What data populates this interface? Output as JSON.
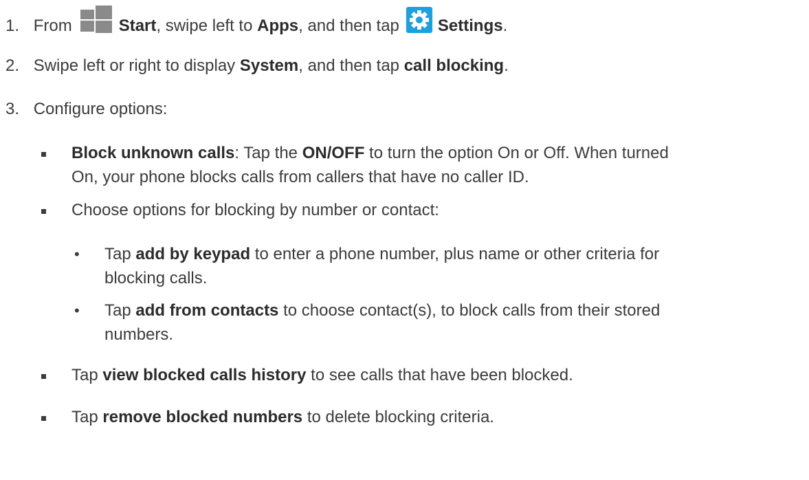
{
  "steps": [
    {
      "num": "1.",
      "p1": "From",
      "start": "Start",
      "p2": ", swipe left to",
      "apps": "Apps",
      "p3": ", and then tap",
      "settings": "Settings",
      "p4": "."
    },
    {
      "num": "2.",
      "p1": "Swipe left or right to display",
      "system": "System",
      "p2": ", and then tap",
      "call_blocking": "call blocking",
      "p3": "."
    },
    {
      "num": "3.",
      "text": "Configure options:"
    }
  ],
  "options": {
    "block_unknown": {
      "bold": "Block unknown calls",
      "t1": ": Tap the",
      "onoff": "ON/OFF",
      "t2": "to turn the option On or Off. When turned",
      "line2": "On, your phone blocks calls from callers that have no caller ID."
    },
    "choose": {
      "text": "Choose options for blocking by number or contact:"
    },
    "keypad": {
      "t1": "Tap",
      "bold": "add by keypad",
      "t2": "to enter a phone number, plus name or other criteria for",
      "line2": "blocking calls."
    },
    "contacts": {
      "t1": "Tap",
      "bold": "add from contacts",
      "t2": "to choose contact(s), to block calls from their stored",
      "line2": "numbers."
    },
    "history": {
      "t1": "Tap",
      "bold": "view blocked calls history",
      "t2": "to see calls that have been blocked."
    },
    "remove": {
      "t1": "Tap",
      "bold": "remove blocked numbers",
      "t2": "to delete blocking criteria."
    }
  },
  "icons": {
    "start": "windows-start-icon",
    "settings": "settings-gear-icon"
  },
  "colors": {
    "settings_tile": "#1ba1e2",
    "start_tile": "#8a8a8a",
    "text": "#3b3b3b"
  }
}
